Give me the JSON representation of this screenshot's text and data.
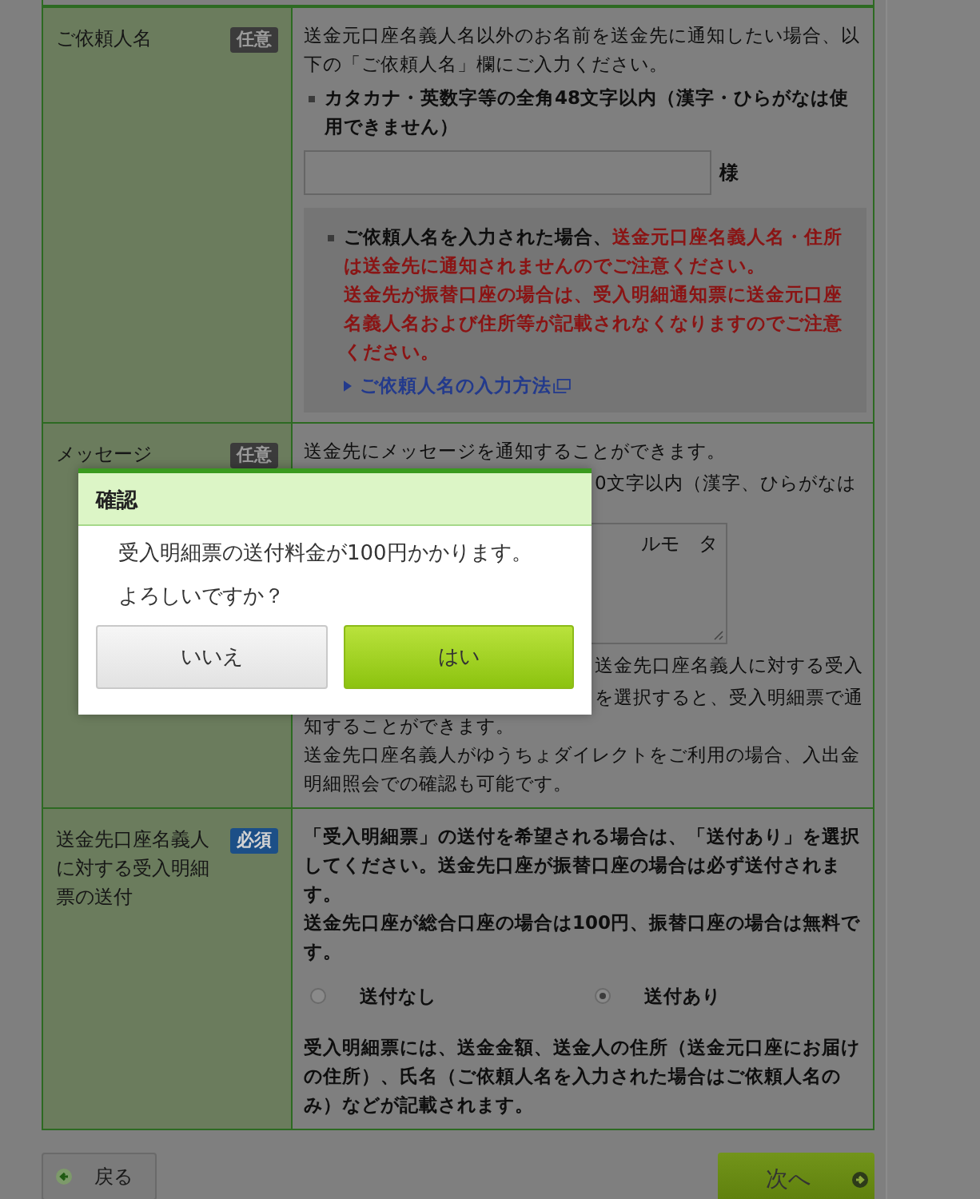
{
  "requester_name": {
    "label": "ご依頼人名",
    "badge": {
      "text": "任意",
      "kind": "optional"
    },
    "intro": "送金元口座名義人名以外のお名前を送金先に通知したい場合、以下の「ご依頼人名」欄にご入力ください。",
    "rule": "カタカナ・英数字等の全角48文字以内（漢字・ひらがなは使用できません）",
    "input": {
      "suffix": "様"
    },
    "notice": {
      "lead": "ご依頼人名を入力された場合、",
      "warning": "送金元口座名義人名・住所は送金先に通知されませんのでご注意ください。",
      "warning_2": "送金先が振替口座の場合は、受入明細通知票に送金元口座名義人名および住所等が記載されなくなりますのでご注意ください。",
      "link": "ご依頼人名の入力方法"
    }
  },
  "message": {
    "label": "メッセージ",
    "badge": {
      "text": "任意",
      "kind": "optional"
    },
    "intro": "送金先にメッセージを通知することができます。",
    "rule_fragment": "0文字以内（漢字、ひらがなは",
    "textarea_fragment": "ルモ　タ",
    "fragments": [
      "送金先口座名義人に対する受入",
      "を選択すると、受入明細票で通"
    ],
    "lines": [
      "知することができます。",
      "送金先口座名義人がゆうちょダイレクトをご利用の場合、入出金明細照会での確認も可能です。"
    ]
  },
  "statement_delivery": {
    "label": "送金先口座名義人に対する受入明細票の送付",
    "badge": {
      "text": "必須",
      "kind": "required"
    },
    "desc": [
      "「受入明細票」の送付を希望される場合は、「送付あり」を選択してください。送金先口座が振替口座の場合は必ず送付されます。",
      "送金先口座が総合口座の場合は100円、振替口座の場合は無料です。"
    ],
    "options": [
      {
        "label": "送付なし",
        "selected": false
      },
      {
        "label": "送付あり",
        "selected": true
      }
    ],
    "note": "受入明細票には、送金金額、送金人の住所（送金元口座にお届けの住所）、氏名（ご依頼人名を入力された場合はご依頼人名のみ）などが記載されます。"
  },
  "nav": {
    "back": "戻る",
    "next": "次へ"
  },
  "dialog": {
    "title": "確認",
    "lines": [
      "受入明細票の送付料金が100円かかります。",
      "よろしいですか？"
    ],
    "buttons": [
      {
        "label": "いいえ",
        "kind": "secondary"
      },
      {
        "label": "はい",
        "kind": "primary"
      }
    ]
  }
}
